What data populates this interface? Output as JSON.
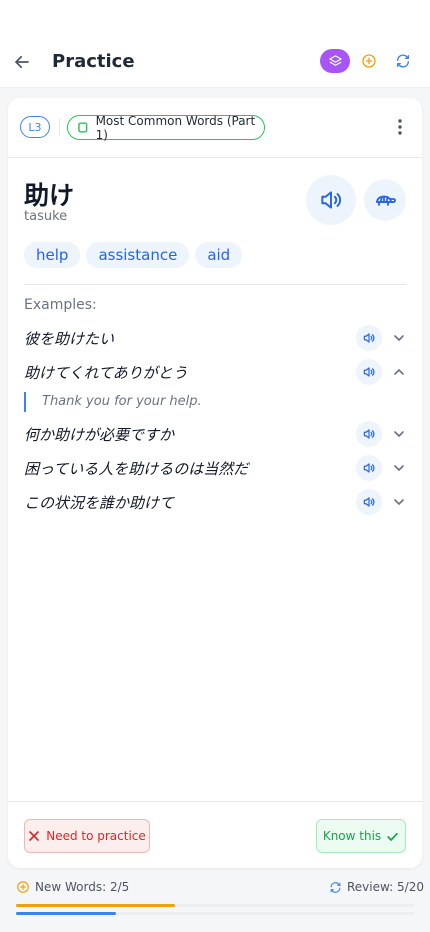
{
  "header": {
    "title": "Practice",
    "icons": [
      "back-arrow-icon",
      "layers-icon",
      "plus-circle-icon",
      "refresh-icon"
    ],
    "colors": {
      "stack_button": "#a855f7",
      "plus": "#f59e0b",
      "refresh": "#3b82f6"
    }
  },
  "card": {
    "level": "L3",
    "deck_name": "Most Common Words (Part 1)",
    "word": "助け",
    "romaji": "tasuke",
    "meanings": [
      "help",
      "assistance",
      "aid"
    ],
    "examples_label": "Examples:",
    "examples": [
      {
        "text": "彼を助けたい",
        "expanded": false
      },
      {
        "text": "助けてくれてありがとう",
        "expanded": true,
        "translation": "Thank you for your help."
      },
      {
        "text": "何か助けが必要ですか",
        "expanded": false
      },
      {
        "text": "困っている人を助けるのは当然だ",
        "expanded": false
      },
      {
        "text": "この状況を誰か助けて",
        "expanded": false
      }
    ],
    "need_practice_label": "Need to practice",
    "know_label": "Know this"
  },
  "progress": {
    "new_words_label": "New Words: 2/5",
    "new_words_fraction": 0.4,
    "review_label": "Review: 5/20",
    "review_fraction": 0.25,
    "colors": {
      "new_words": "#f59e0b",
      "review": "#3b82f6"
    }
  }
}
